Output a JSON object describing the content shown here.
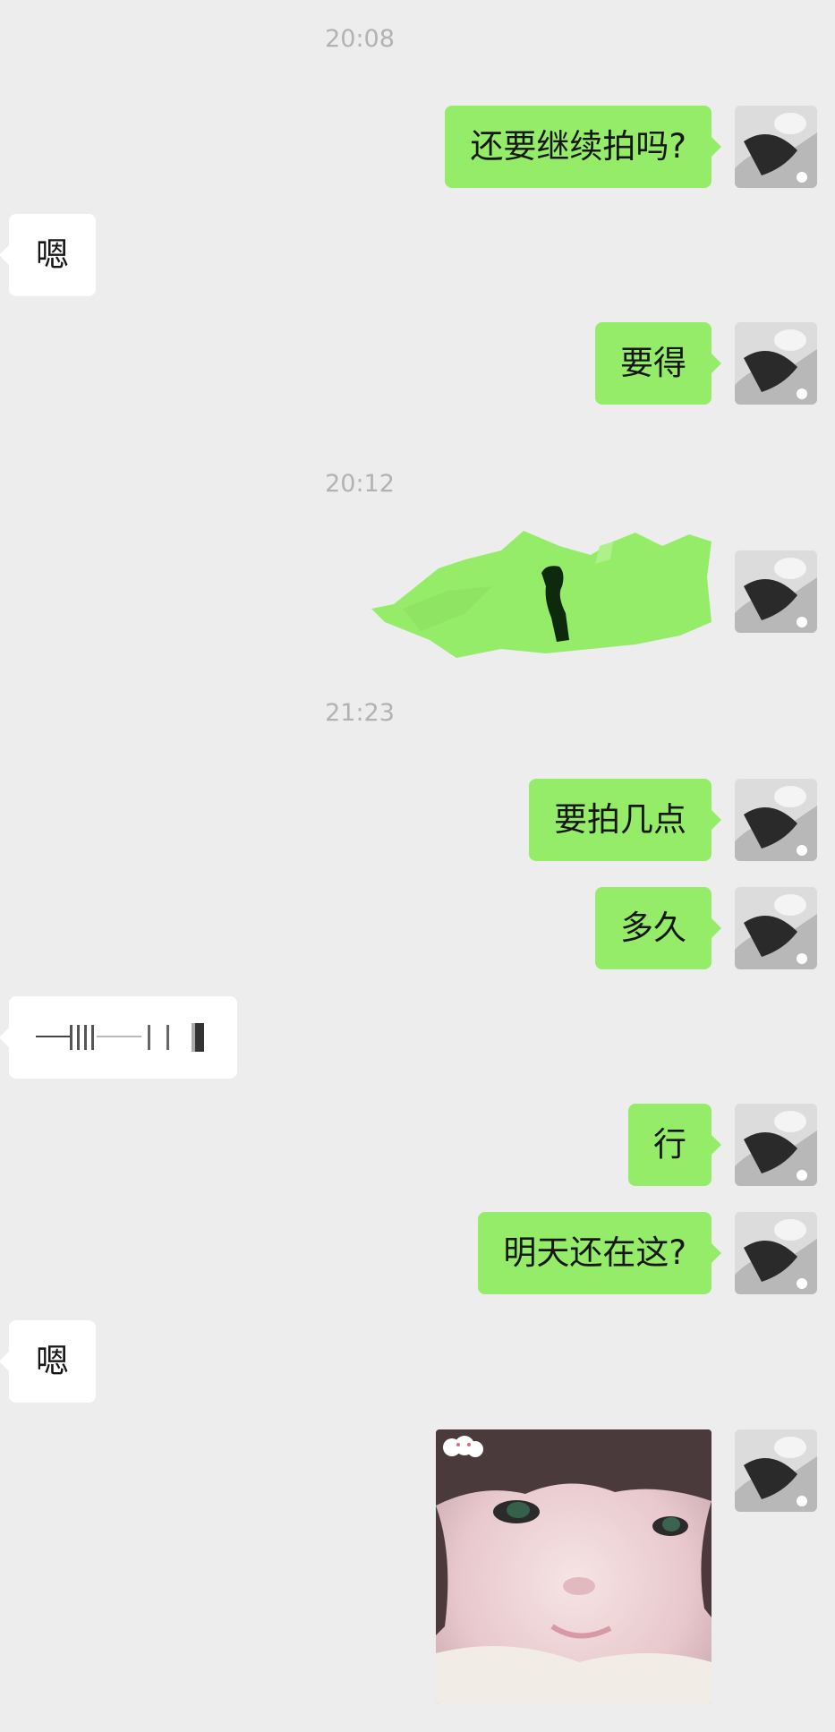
{
  "timestamps": [
    "20:08",
    "20:12",
    "21:23"
  ],
  "messages": {
    "m1": "还要继续拍吗?",
    "m2": "嗯",
    "m3": "要得",
    "m5": "要拍几点",
    "m6": "多久",
    "m8": "行",
    "m9": "明天还在这?",
    "m10": "嗯"
  },
  "colors": {
    "background": "#ededed",
    "my_bubble": "#95ec69",
    "their_bubble": "#ffffff",
    "timestamp_text": "#b2b2b2"
  },
  "icons": {
    "avatar": "user-avatar-photo",
    "redaction": "green-scribble-redaction",
    "voice": "voice-waveform-icon",
    "photo": "baby-face-photo"
  }
}
